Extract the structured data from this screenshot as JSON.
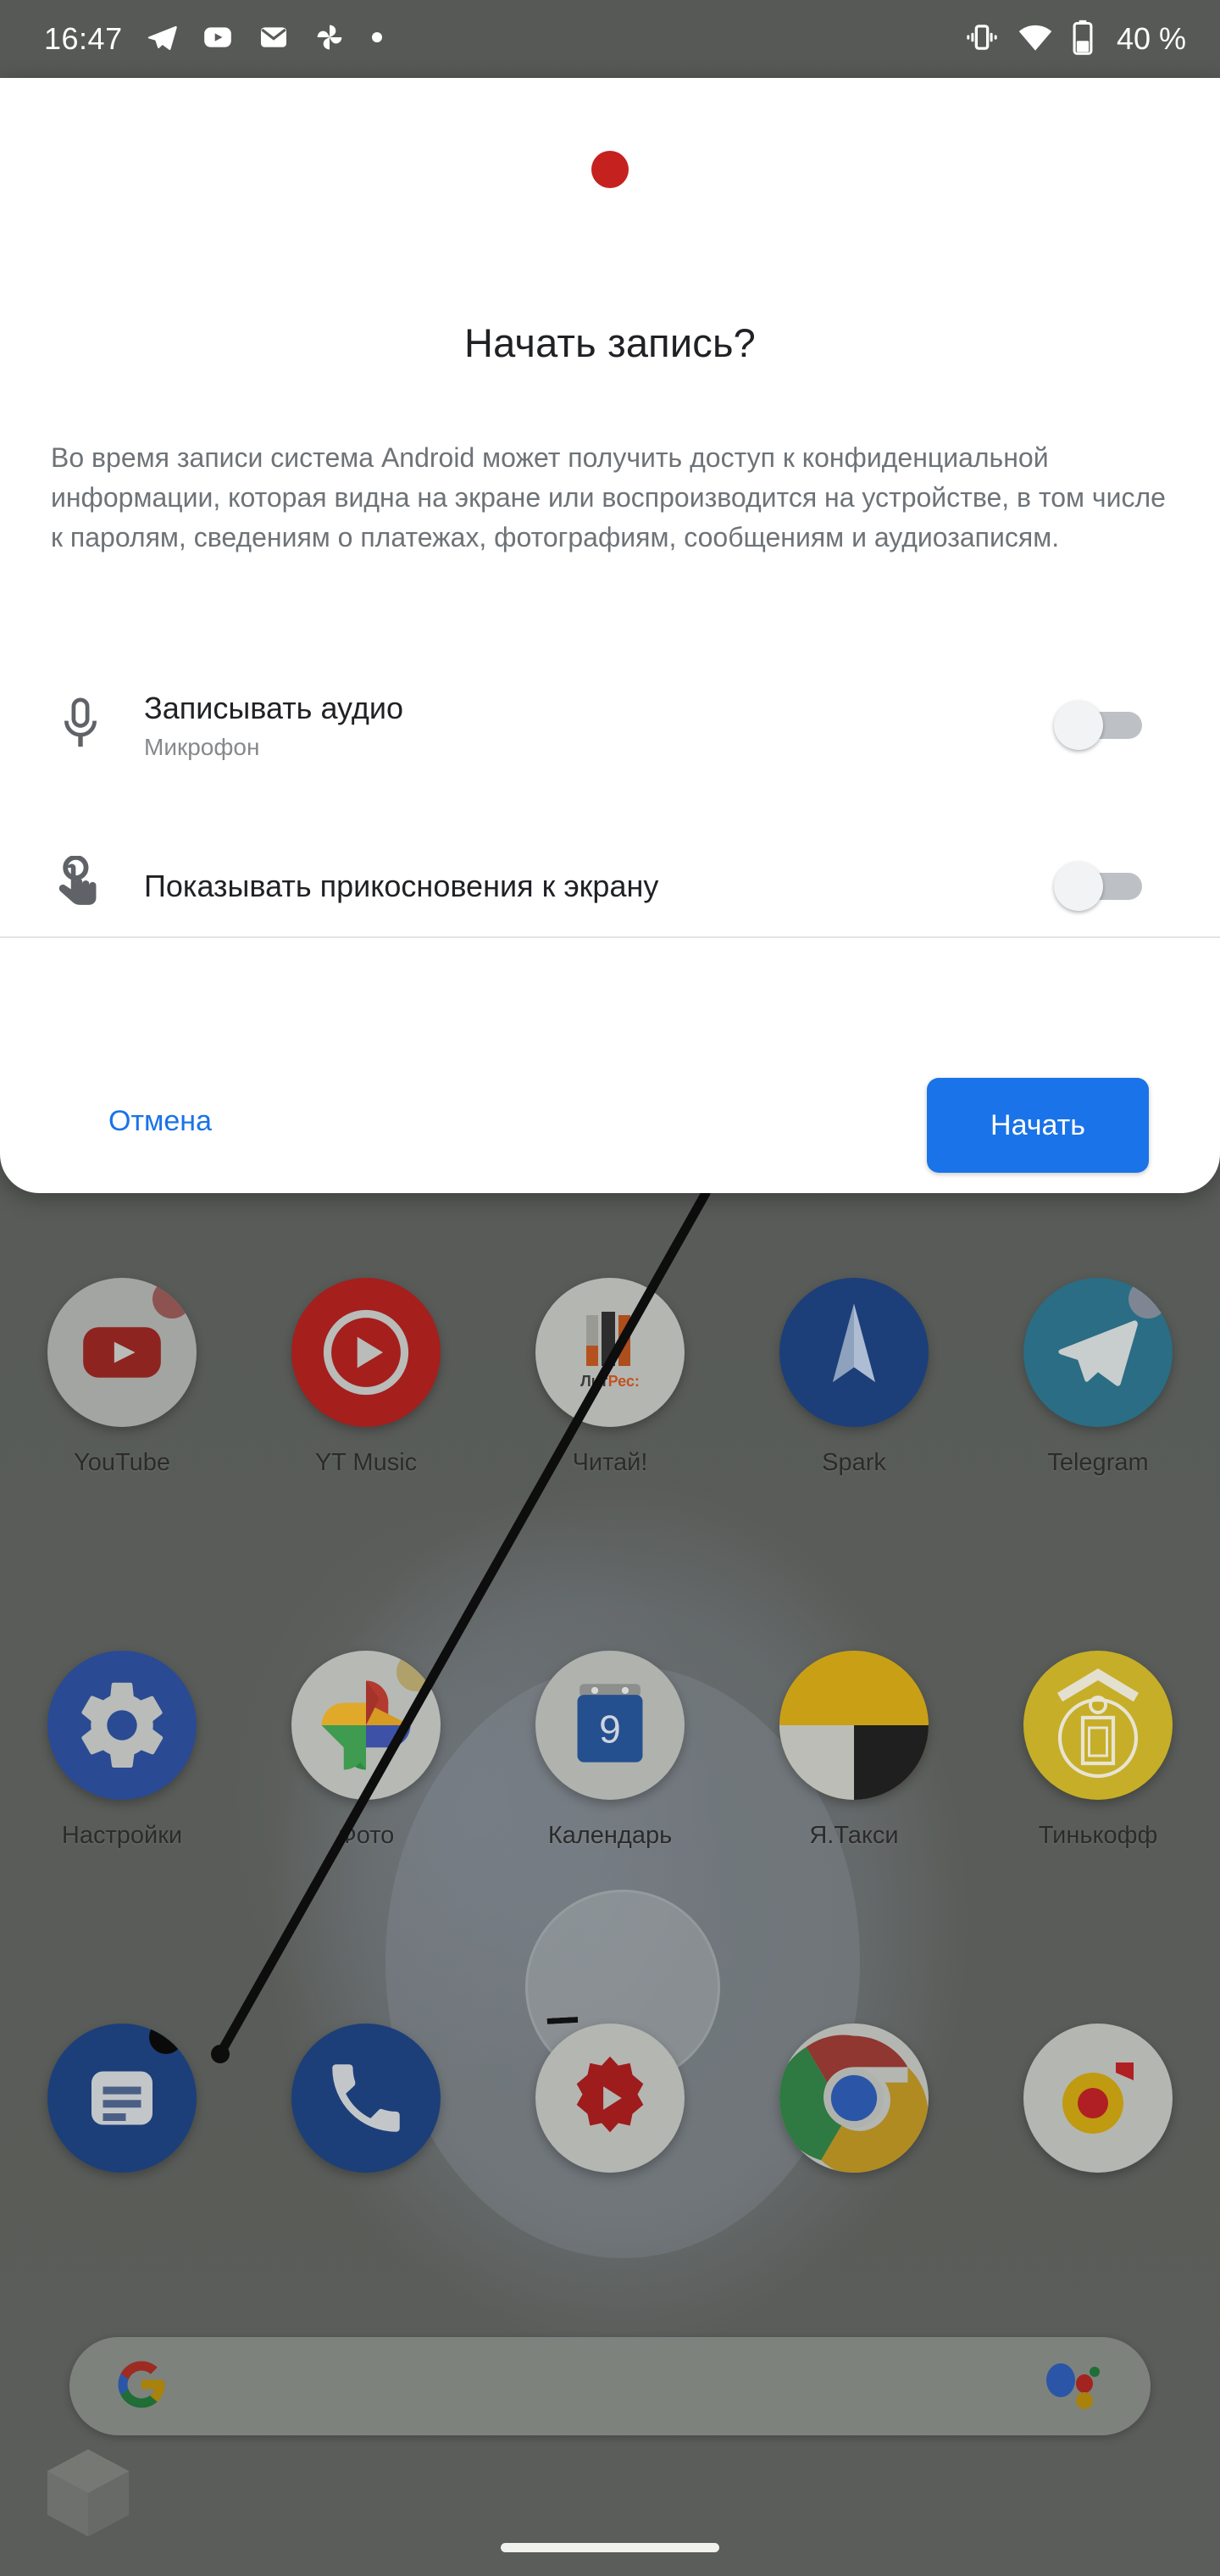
{
  "status_bar": {
    "clock": "16:47",
    "battery_text": "40 %",
    "left_icons": [
      "telegram-icon",
      "youtube-icon",
      "mail-icon",
      "pinwheel-icon",
      "dot-icon"
    ],
    "right_icons": [
      "vibrate-icon",
      "wifi-icon",
      "battery-icon"
    ]
  },
  "dialog": {
    "record_indicator": "record-dot-icon",
    "title": "Начать запись?",
    "body": "Во время записи система Android может получить доступ к конфиденциальной информации, которая видна на экране или воспроизводится на устройстве, в том числе к паролям, сведениям о платежах, фотографиям, сообщениям и аудиозаписям.",
    "options": [
      {
        "icon": "microphone-icon",
        "title": "Записывать аудио",
        "subtitle": "Микрофон",
        "enabled": false
      },
      {
        "icon": "touch-indicator-icon",
        "title": "Показывать прикосновения к экрану",
        "subtitle": "",
        "enabled": false
      }
    ],
    "cancel_label": "Отмена",
    "start_label": "Начать",
    "accent_color": "#1a73e8",
    "record_color": "#c5221f"
  },
  "home_screen": {
    "rows": [
      [
        {
          "label": "YouTube",
          "icon": "youtube-app-icon",
          "badge": "#c53a35"
        },
        {
          "label": "YT Music",
          "icon": "yt-music-app-icon",
          "badge": ""
        },
        {
          "label": "Читай!",
          "icon": "litres-app-icon",
          "badge": ""
        },
        {
          "label": "Spark",
          "icon": "spark-app-icon",
          "badge": ""
        },
        {
          "label": "Telegram",
          "icon": "telegram-app-icon",
          "badge": "#7e8694"
        }
      ],
      [
        {
          "label": "Настройки",
          "icon": "settings-app-icon",
          "badge": ""
        },
        {
          "label": "Фото",
          "icon": "google-photos-app-icon",
          "badge": "#b0a06a"
        },
        {
          "label": "Календарь",
          "icon": "calendar-app-icon",
          "badge": "",
          "day": "9"
        },
        {
          "label": "Я.Такси",
          "icon": "yandex-taxi-app-icon",
          "badge": ""
        },
        {
          "label": "Тинькофф",
          "icon": "tinkoff-app-icon",
          "badge": ""
        }
      ],
      [
        {
          "label": "",
          "icon": "messages-app-icon",
          "badge": "#0a0a0a"
        },
        {
          "label": "",
          "icon": "phone-app-icon",
          "badge": ""
        },
        {
          "label": "",
          "icon": "play-store-settings-app-icon",
          "badge": ""
        },
        {
          "label": "",
          "icon": "chrome-app-icon",
          "badge": ""
        },
        {
          "label": "",
          "icon": "music-app-icon",
          "badge": ""
        }
      ]
    ],
    "search_bar": {
      "logo": "google-g-icon",
      "assistant": "google-assistant-icon",
      "placeholder": ""
    },
    "widget": "hexagon-widget-icon",
    "nav_pill": "gesture-nav-pill"
  }
}
